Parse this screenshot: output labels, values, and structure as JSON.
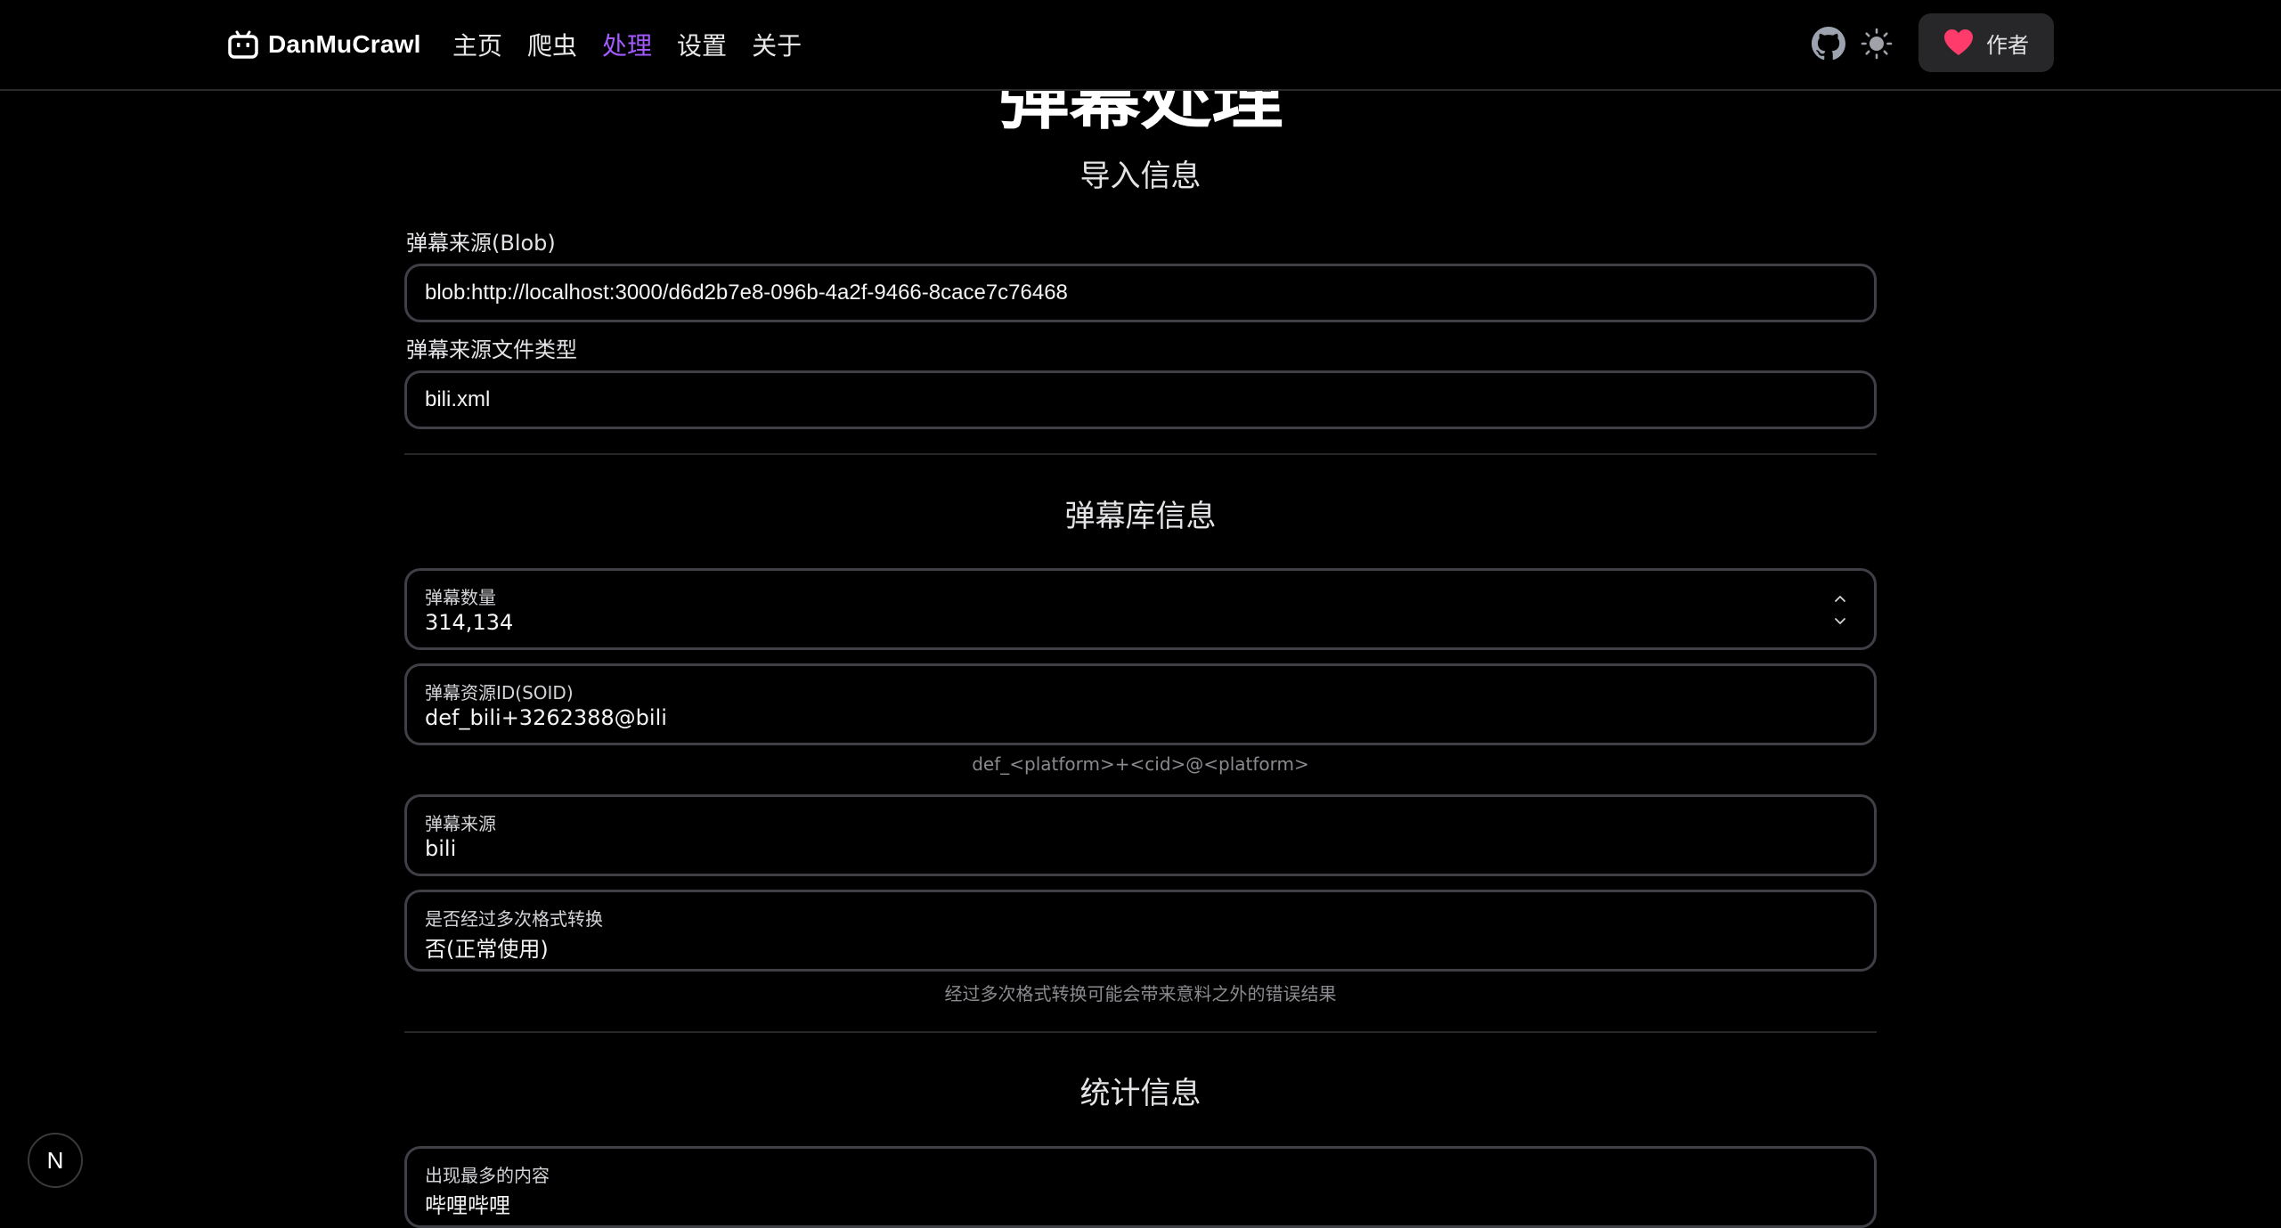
{
  "navbar": {
    "brand": "DanMuCrawl",
    "links": [
      "主页",
      "爬虫",
      "处理",
      "设置",
      "关于"
    ],
    "author_label": "作者"
  },
  "page": {
    "title": "弹幕处理"
  },
  "import_section": {
    "heading": "导入信息",
    "source_label": "弹幕来源(Blob)",
    "source_value": "blob:http://localhost:3000/d6d2b7e8-096b-4a2f-9466-8cace7c76468",
    "type_label": "弹幕来源文件类型",
    "type_value": "bili.xml"
  },
  "library_section": {
    "heading": "弹幕库信息",
    "count_label": "弹幕数量",
    "count_value": "314,134",
    "soid_label": "弹幕资源ID(SOID)",
    "soid_value": "def_bili+3262388@bili",
    "soid_hint": "def_<platform>+<cid>@<platform>",
    "from_label": "弹幕来源",
    "from_value": "bili",
    "converted_label": "是否经过多次格式转换",
    "converted_value": "否(正常使用)",
    "converted_hint": "经过多次格式转换可能会带来意料之外的错误结果"
  },
  "stats_section": {
    "heading": "统计信息",
    "top_content_label": "出现最多的内容",
    "top_content_value": "哔哩哔哩"
  },
  "badge": {
    "letter": "N"
  },
  "colors": {
    "background": "#000000",
    "accent": "#a35bff",
    "heart": "#ff3b6b",
    "border": "#3f3f46"
  }
}
